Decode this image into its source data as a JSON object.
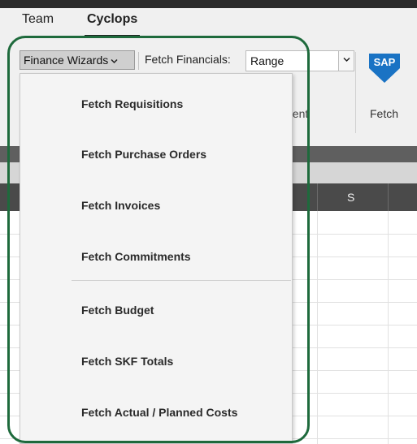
{
  "ribbon": {
    "tabs": [
      "Team",
      "Cyclops"
    ],
    "active_tab": "Cyclops",
    "finance_wizards_label": "Finance Wizards",
    "fetch_financials_label": "Fetch Financials:",
    "fetch_financials_value": "Range",
    "partial_group_label": "nent",
    "sap_logo_text": "SAP",
    "fetch_group_label": "Fetch"
  },
  "sheet": {
    "visible_column_header": "S"
  },
  "dropdown": {
    "items": [
      "Fetch Requisitions",
      "Fetch Purchase Orders",
      "Fetch Invoices",
      "Fetch Commitments",
      "Fetch Budget",
      "Fetch SKF Totals",
      "Fetch Actual / Planned Costs"
    ]
  },
  "colors": {
    "highlight_border": "#1e6a3c",
    "sap_blue": "#1a73c4",
    "ribbon_bg": "#f0f0f0",
    "menu_bg": "#f4f4f4"
  }
}
